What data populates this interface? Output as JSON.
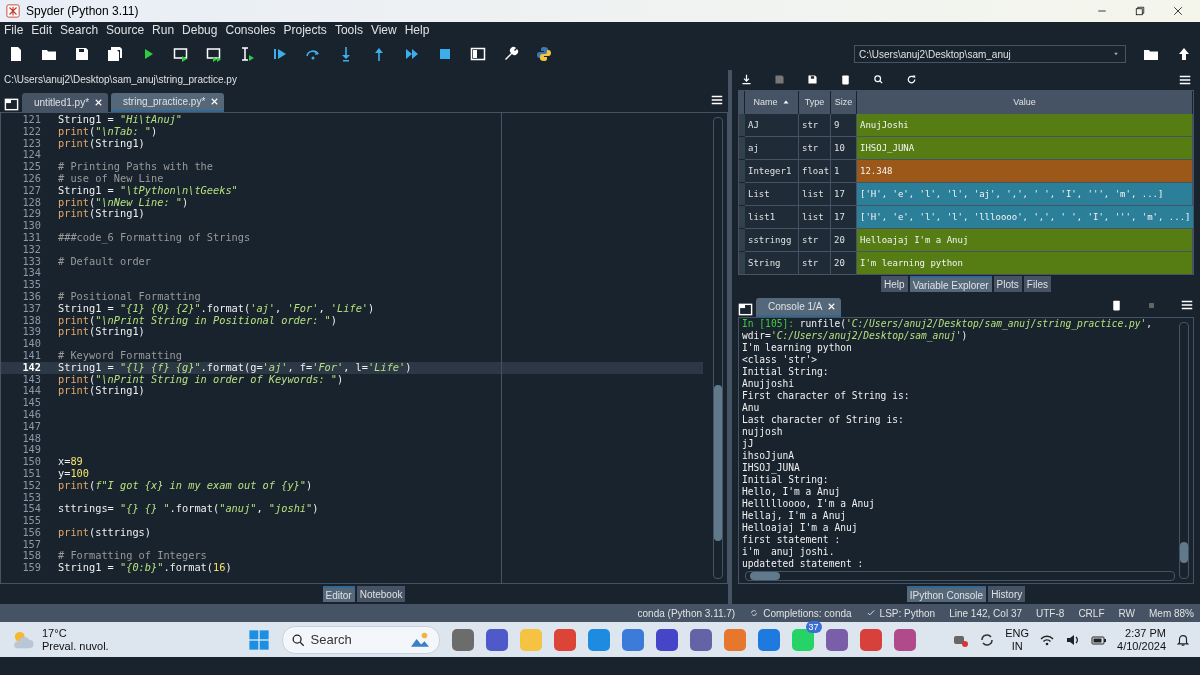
{
  "window": {
    "title": "Spyder (Python 3.11)"
  },
  "menu": [
    "File",
    "Edit",
    "Search",
    "Source",
    "Run",
    "Debug",
    "Consoles",
    "Projects",
    "Tools",
    "View",
    "Help"
  ],
  "toolbar": {
    "path": "C:\\Users\\anuj2\\Desktop\\sam_anuj"
  },
  "editor": {
    "path": "C:\\Users\\anuj2\\Desktop\\sam_anuj\\string_practice.py",
    "tabs": [
      {
        "label": "untitled1.py*",
        "selected": false
      },
      {
        "label": "string_practice.py*",
        "selected": true
      }
    ],
    "lines": [
      {
        "number": "121",
        "current": false,
        "segments": [
          {
            "kind": "plain",
            "text": "String1 = "
          },
          {
            "kind": "string",
            "text": "\"Hi\\tAnuj\""
          }
        ]
      },
      {
        "number": "122",
        "current": false,
        "segments": [
          {
            "kind": "builtin",
            "text": "print"
          },
          {
            "kind": "plain",
            "text": "("
          },
          {
            "kind": "string",
            "text": "\"\\nTab: \""
          },
          {
            "kind": "plain",
            "text": ")"
          }
        ]
      },
      {
        "number": "123",
        "current": false,
        "segments": [
          {
            "kind": "builtin",
            "text": "print"
          },
          {
            "kind": "plain",
            "text": "(String1)"
          }
        ]
      },
      {
        "number": "124",
        "current": false
      },
      {
        "number": "125",
        "current": false,
        "segments": [
          {
            "kind": "comment",
            "text": "# Printing Paths with the"
          }
        ]
      },
      {
        "number": "126",
        "current": false,
        "segments": [
          {
            "kind": "comment",
            "text": "# use of New Line"
          }
        ]
      },
      {
        "number": "127",
        "current": false,
        "segments": [
          {
            "kind": "plain",
            "text": "String1 = "
          },
          {
            "kind": "string",
            "text": "\"\\tPython\\n\\tGeeks\""
          }
        ]
      },
      {
        "number": "128",
        "current": false,
        "segments": [
          {
            "kind": "builtin",
            "text": "print"
          },
          {
            "kind": "plain",
            "text": "("
          },
          {
            "kind": "string",
            "text": "\"\\nNew Line: \""
          },
          {
            "kind": "plain",
            "text": ")"
          }
        ]
      },
      {
        "number": "129",
        "current": false,
        "segments": [
          {
            "kind": "builtin",
            "text": "print"
          },
          {
            "kind": "plain",
            "text": "(String1)"
          }
        ]
      },
      {
        "number": "130",
        "current": false
      },
      {
        "number": "131",
        "current": false,
        "segments": [
          {
            "kind": "comment",
            "text": "###code_6 Formatting of Strings"
          }
        ]
      },
      {
        "number": "132",
        "current": false
      },
      {
        "number": "133",
        "current": false,
        "segments": [
          {
            "kind": "comment",
            "text": "# Default order"
          }
        ]
      },
      {
        "number": "134",
        "current": false
      },
      {
        "number": "135",
        "current": false
      },
      {
        "number": "136",
        "current": false,
        "segments": [
          {
            "kind": "comment",
            "text": "# Positional Formatting"
          }
        ]
      },
      {
        "number": "137",
        "current": false,
        "segments": [
          {
            "kind": "plain",
            "text": "String1 = "
          },
          {
            "kind": "string",
            "text": "\"{1} {0} {2}\""
          },
          {
            "kind": "plain",
            "text": ".format("
          },
          {
            "kind": "string",
            "text": "'aj'"
          },
          {
            "kind": "plain",
            "text": ", "
          },
          {
            "kind": "string",
            "text": "'For'"
          },
          {
            "kind": "plain",
            "text": ", "
          },
          {
            "kind": "string",
            "text": "'Life'"
          },
          {
            "kind": "plain",
            "text": ")"
          }
        ]
      },
      {
        "number": "138",
        "current": false,
        "segments": [
          {
            "kind": "builtin",
            "text": "print"
          },
          {
            "kind": "plain",
            "text": "("
          },
          {
            "kind": "string",
            "text": "\"\\nPrint String in Positional order: \""
          },
          {
            "kind": "plain",
            "text": ")"
          }
        ]
      },
      {
        "number": "139",
        "current": false,
        "segments": [
          {
            "kind": "builtin",
            "text": "print"
          },
          {
            "kind": "plain",
            "text": "(String1)"
          }
        ]
      },
      {
        "number": "140",
        "current": false
      },
      {
        "number": "141",
        "current": false,
        "segments": [
          {
            "kind": "comment",
            "text": "# Keyword Formatting"
          }
        ]
      },
      {
        "number": "142",
        "current": true,
        "segments": [
          {
            "kind": "plain",
            "text": "String1 = "
          },
          {
            "kind": "string",
            "text": "\"{l} {f} {g}\""
          },
          {
            "kind": "plain",
            "text": ".format(g="
          },
          {
            "kind": "string",
            "text": "'aj'"
          },
          {
            "kind": "plain",
            "text": ", f="
          },
          {
            "kind": "string",
            "text": "'For'"
          },
          {
            "kind": "plain",
            "text": ", l="
          },
          {
            "kind": "string",
            "text": "'Life'"
          },
          {
            "kind": "plain",
            "text": ")"
          }
        ]
      },
      {
        "number": "143",
        "current": false,
        "segments": [
          {
            "kind": "builtin",
            "text": "print"
          },
          {
            "kind": "plain",
            "text": "("
          },
          {
            "kind": "string",
            "text": "\"\\nPrint String in order of Keywords: \""
          },
          {
            "kind": "plain",
            "text": ")"
          }
        ]
      },
      {
        "number": "144",
        "current": false,
        "segments": [
          {
            "kind": "builtin",
            "text": "print"
          },
          {
            "kind": "plain",
            "text": "(String1)"
          }
        ]
      },
      {
        "number": "145",
        "current": false
      },
      {
        "number": "146",
        "current": false
      },
      {
        "number": "147",
        "current": false
      },
      {
        "number": "148",
        "current": false
      },
      {
        "number": "149",
        "current": false
      },
      {
        "number": "150",
        "current": false,
        "segments": [
          {
            "kind": "plain",
            "text": "x="
          },
          {
            "kind": "number",
            "text": "89"
          }
        ]
      },
      {
        "number": "151",
        "current": false,
        "segments": [
          {
            "kind": "plain",
            "text": "y="
          },
          {
            "kind": "number",
            "text": "100"
          }
        ]
      },
      {
        "number": "152",
        "current": false,
        "segments": [
          {
            "kind": "builtin",
            "text": "print"
          },
          {
            "kind": "plain",
            "text": "("
          },
          {
            "kind": "string",
            "text": "f\"I got {x} in my exam out of {y}\""
          },
          {
            "kind": "plain",
            "text": ")"
          }
        ]
      },
      {
        "number": "153",
        "current": false
      },
      {
        "number": "154",
        "current": false,
        "segments": [
          {
            "kind": "plain",
            "text": "sttrings= "
          },
          {
            "kind": "string",
            "text": "\"{} {} \""
          },
          {
            "kind": "plain",
            "text": ".format("
          },
          {
            "kind": "string",
            "text": "\"anuj\""
          },
          {
            "kind": "plain",
            "text": ", "
          },
          {
            "kind": "string",
            "text": "\"joshi\""
          },
          {
            "kind": "plain",
            "text": ")"
          }
        ]
      },
      {
        "number": "155",
        "current": false
      },
      {
        "number": "156",
        "current": false,
        "segments": [
          {
            "kind": "builtin",
            "text": "print"
          },
          {
            "kind": "plain",
            "text": "(sttrings)"
          }
        ]
      },
      {
        "number": "157",
        "current": false
      },
      {
        "number": "158",
        "current": false,
        "segments": [
          {
            "kind": "comment",
            "text": "# Formatting of Integers"
          }
        ]
      },
      {
        "number": "159",
        "current": false,
        "segments": [
          {
            "kind": "plain",
            "text": "String1 = "
          },
          {
            "kind": "string",
            "text": "\"{0:b}\""
          },
          {
            "kind": "plain",
            "text": ".format("
          },
          {
            "kind": "number",
            "text": "16"
          },
          {
            "kind": "plain",
            "text": ")"
          }
        ]
      }
    ],
    "bottom_tabs": [
      {
        "label": "Editor",
        "selected": true
      },
      {
        "label": "Notebook",
        "selected": false
      }
    ]
  },
  "variable_explorer": {
    "columns": [
      "Name",
      "Type",
      "Size",
      "Value"
    ],
    "rows": [
      {
        "name": "AJ",
        "type": "str",
        "size": "9",
        "value": "AnujJoshi",
        "color": "#567d14"
      },
      {
        "name": "aj",
        "type": "str",
        "size": "10",
        "value": "IHSOJ_JUNA",
        "color": "#567d14"
      },
      {
        "name": "Integer1",
        "type": "float",
        "size": "1",
        "value": "12.348",
        "color": "#9c5818"
      },
      {
        "name": "List",
        "type": "list",
        "size": "17",
        "value": "['H', 'e', 'l', 'l', 'aj', ',', ' ', 'I', ''', 'm', ...]",
        "color": "#2b7f99"
      },
      {
        "name": "list1",
        "type": "list",
        "size": "17",
        "value": "['H', 'e', 'l', 'l', 'llloooo', ',', ' ', 'I', ''', 'm', ...]",
        "color": "#2b7f99"
      },
      {
        "name": "sstringg",
        "type": "str",
        "size": "20",
        "value": "Helloajaj I'm a Anuj",
        "color": "#567d14"
      },
      {
        "name": "String",
        "type": "str",
        "size": "20",
        "value": "I'm learning python",
        "color": "#567d14"
      }
    ]
  },
  "top_tabs": [
    {
      "label": "Help",
      "selected": false
    },
    {
      "label": "Variable Explorer",
      "selected": true
    },
    {
      "label": "Plots",
      "selected": false
    },
    {
      "label": "Files",
      "selected": false
    }
  ],
  "console": {
    "tabs": [
      {
        "label": "Console 1/A",
        "selected": true
      }
    ],
    "lines": [
      {
        "segments": [
          {
            "kind": "prompt",
            "text": "In [105]: "
          },
          {
            "kind": "plain",
            "text": "runfile("
          },
          {
            "kind": "string",
            "text": "'C:/Users/anuj2/Desktop/sam_anuj/string_practice.py'"
          },
          {
            "kind": "plain",
            "text": ","
          }
        ]
      },
      {
        "segments": [
          {
            "kind": "plain",
            "text": "wdir="
          },
          {
            "kind": "string",
            "text": "'C:/Users/anuj2/Desktop/sam_anuj'"
          },
          {
            "kind": "plain",
            "text": ")"
          }
        ]
      },
      {
        "text": "I'm learning python"
      },
      {
        "text": "<class 'str'>"
      },
      {
        "text": "Initial String:"
      },
      {
        "text": "Anujjoshi"
      },
      {
        "text": "First character of String is:"
      },
      {
        "text": "Anu"
      },
      {
        "text": "Last character of String is:"
      },
      {
        "text": "nujjosh"
      },
      {
        "text": "jJ"
      },
      {
        "text": "ihsoJjunA"
      },
      {
        "text": "IHSOJ_JUNA"
      },
      {
        "text": "Initial String:"
      },
      {
        "text": "Hello, I'm a Anuj"
      },
      {
        "text": "Hellllloooo, I'm a Anuj"
      },
      {
        "text": "Hellaj, I'm a Anuj"
      },
      {
        "text": "Helloajaj I'm a Anuj"
      },
      {
        "text": "first statement :"
      },
      {
        "text": "i'm  anuj joshi."
      },
      {
        "text": "updateted statement :"
      }
    ],
    "bottom_tabs": [
      {
        "label": "IPython Console",
        "selected": true
      },
      {
        "label": "History",
        "selected": false
      }
    ]
  },
  "status_bar": [
    {
      "kind": "plain",
      "text": "conda (Python 3.11.7)"
    },
    {
      "kind": "completions",
      "text": "Completions: conda"
    },
    {
      "kind": "lsp",
      "text": "LSP: Python"
    },
    {
      "kind": "plain",
      "text": "Line 142, Col 37"
    },
    {
      "kind": "plain",
      "text": "UTF-8"
    },
    {
      "kind": "plain",
      "text": "CRLF"
    },
    {
      "kind": "plain",
      "text": "RW"
    },
    {
      "kind": "plain",
      "text": "Mem 88%"
    }
  ],
  "taskbar": {
    "weather": {
      "temperature": "17°C",
      "condition": "Preval. nuvol."
    },
    "search": {
      "placeholder": "Search"
    },
    "badge": "37",
    "language": "ENG",
    "region": "IN",
    "time": "2:37 PM",
    "date": "4/10/2024"
  }
}
